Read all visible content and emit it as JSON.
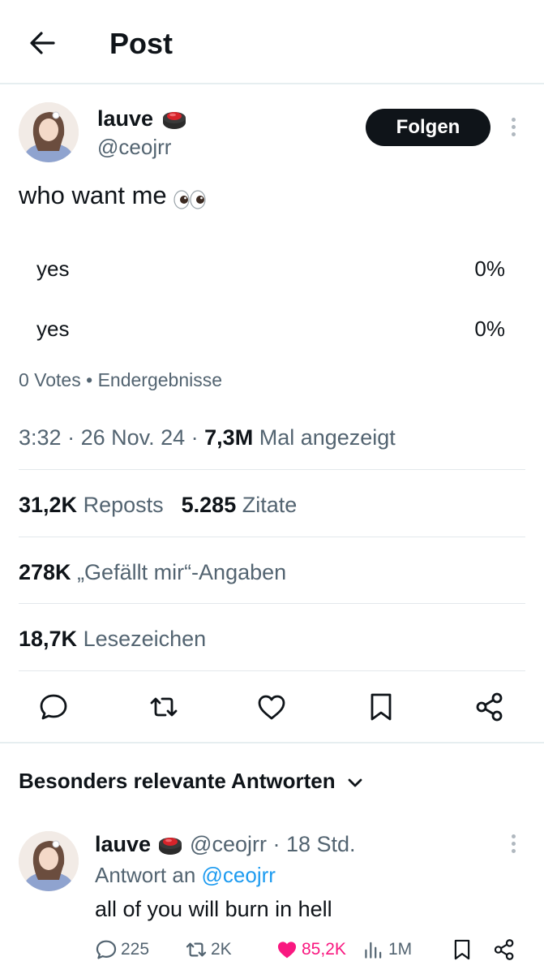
{
  "header": {
    "title": "Post",
    "back_icon": "arrow-left-icon"
  },
  "post": {
    "author": {
      "display_name": "lauve",
      "handle": "@ceojrr",
      "badge_icon": "red-button-emoji-icon"
    },
    "follow_label": "Folgen",
    "text": "who want me",
    "text_emoji": "eyes-emoji-icon",
    "poll": {
      "options": [
        {
          "label": "yes",
          "percent": "0%"
        },
        {
          "label": "yes",
          "percent": "0%"
        }
      ],
      "votes": "0 Votes",
      "separator": "•",
      "status": "Endergebnisse"
    },
    "time": "3:32",
    "date": "26 Nov. 24",
    "views_count": "7,3M",
    "views_label": "Mal angezeigt",
    "stats": {
      "reposts_count": "31,2K",
      "reposts_label": "Reposts",
      "quotes_count": "5.285",
      "quotes_label": "Zitate",
      "likes_count": "278K",
      "likes_label": "„Gefällt mir“-Angaben",
      "bookmarks_count": "18,7K",
      "bookmarks_label": "Lesezeichen"
    },
    "actions": [
      "reply-icon",
      "repost-icon",
      "like-icon",
      "bookmark-icon",
      "share-icon"
    ]
  },
  "replies_section": {
    "title": "Besonders relevante Antworten",
    "chevron_icon": "chevron-down-icon"
  },
  "reply": {
    "display_name": "lauve",
    "handle": "@ceojrr",
    "time": "· 18 Std.",
    "reply_to_label": "Antwort an",
    "reply_to_handle": "@ceojrr",
    "text": "all of you will burn in hell",
    "replies": "225",
    "reposts": "2K",
    "likes": "85,2K",
    "views": "1M"
  },
  "colors": {
    "text": "#0f1419",
    "secondary": "#536471",
    "link": "#1d9bf0",
    "like": "#f91880",
    "follow_bg": "#0f1419"
  }
}
